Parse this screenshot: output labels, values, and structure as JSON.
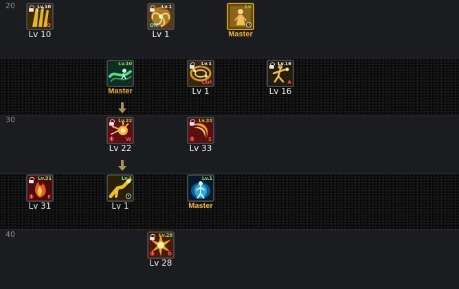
{
  "level_rows": [
    {
      "label": "20",
      "style": "dark"
    },
    {
      "label": "",
      "style": "speckled"
    },
    {
      "label": "30",
      "style": "dark"
    },
    {
      "label": "",
      "style": "speckled"
    },
    {
      "label": "40",
      "style": "dark"
    }
  ],
  "skills": [
    {
      "icon": "yellow-claw-icon",
      "req": "Lv.10",
      "locked": true,
      "key": "Q",
      "caption": "Lv 10"
    },
    {
      "icon": "spiral-vortex-icon",
      "req": "Lv.1",
      "locked": true,
      "on": "ON",
      "caption": "Lv 1"
    },
    {
      "icon": "robed-figure-icon",
      "req": "Lv.",
      "locked": false,
      "clock": true,
      "caption": "Master",
      "selected": true
    },
    {
      "icon": "green-wave-icon",
      "req": "Lv.10",
      "locked": false,
      "caption": "Master"
    },
    {
      "icon": "yellow-swirl-icon",
      "req": "Lv.1",
      "locked": true,
      "key": "Ctrl",
      "caption": "Lv 1"
    },
    {
      "icon": "running-figure-icon",
      "req": "Lv.16",
      "locked": true,
      "key": "A",
      "caption": "Lv 16"
    },
    {
      "icon": "red-burst-icon",
      "req": "Lv.22",
      "locked": true,
      "key": "W",
      "warn": "!",
      "caption": "Lv 22"
    },
    {
      "icon": "red-crescent-icon",
      "req": "Lv.33",
      "locked": true,
      "key": "S",
      "warn": "!",
      "caption": "Lv 33"
    },
    {
      "icon": "red-flame-icon",
      "req": "Lv.31",
      "locked": true,
      "key": "E",
      "warn": "!",
      "caption": "Lv 31"
    },
    {
      "icon": "yellow-kick-icon",
      "req": "Lv.1",
      "locked": false,
      "clock": true,
      "caption": "Lv 1"
    },
    {
      "icon": "blue-aura-figure-icon",
      "req": "Lv.1",
      "locked": false,
      "caption": "Master"
    },
    {
      "icon": "gold-explosion-icon",
      "req": "Lv.28",
      "locked": true,
      "key": "D",
      "warn": "!",
      "caption": "Lv 28"
    }
  ],
  "colors": {
    "master_text": "#f5b81f",
    "level_text": "#f2f2f2",
    "requirement_met": "#7ee05a",
    "hotkey": "#ff5555",
    "warning": "#e02020",
    "arrow": "#a8925a"
  }
}
